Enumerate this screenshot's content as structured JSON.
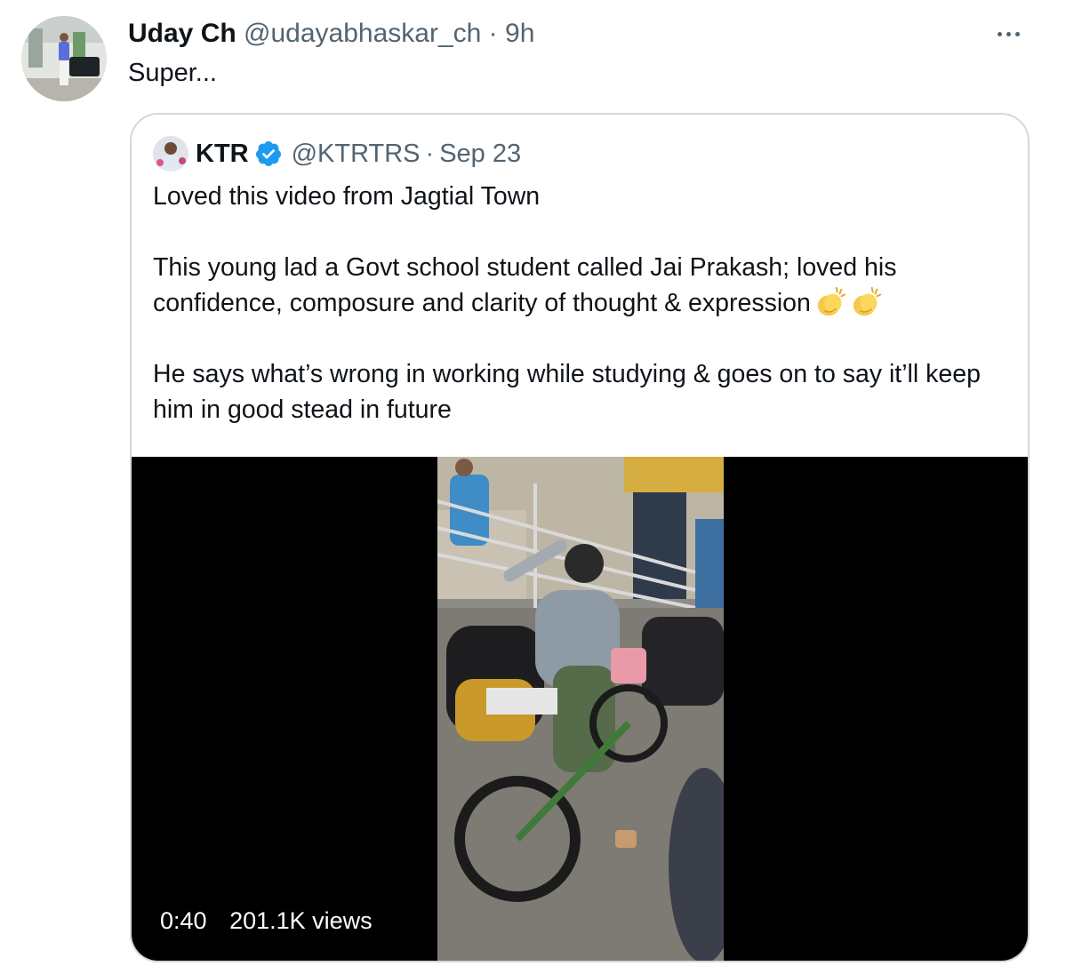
{
  "tweet": {
    "author_name": "Uday Ch",
    "author_handle": "@udayabhaskar_ch",
    "separator": "·",
    "time": "9h",
    "text": "Super...",
    "more_icon": "more-horizontal-icon"
  },
  "quoted_tweet": {
    "author_name": "KTR",
    "verified_icon": "verified-badge-icon",
    "verified_color": "#1d9bf0",
    "author_handle": "@KTRTRS",
    "separator": "·",
    "date": "Sep 23",
    "paragraphs": [
      "Loved this video from Jagtial Town",
      "This young lad a Govt school student called Jai Prakash; loved his confidence, composure and clarity of thought & expression",
      "He says what’s wrong in working while studying & goes on to say it’ll keep him in good stead in future"
    ],
    "emoji": [
      "clapping-hands-icon",
      "clapping-hands-icon"
    ],
    "video": {
      "duration": "0:40",
      "views": "201.1K views"
    }
  },
  "colors": {
    "text": "#0f1419",
    "muted": "#536471",
    "border": "#cfd9de",
    "video_bg": "#000000"
  }
}
